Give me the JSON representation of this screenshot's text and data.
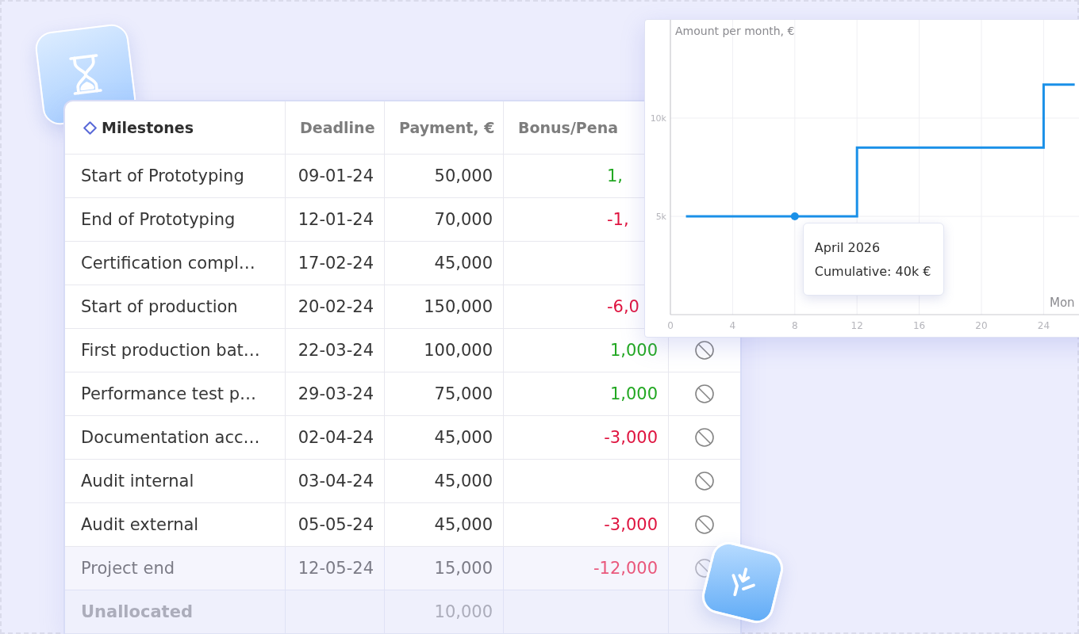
{
  "table": {
    "columns": [
      {
        "label": "Milestones",
        "kind": "title"
      },
      {
        "label": "Deadline",
        "kind": "value"
      },
      {
        "label": "Payment, €",
        "kind": "value"
      },
      {
        "label": "Bonus/Pena",
        "kind": "value"
      }
    ],
    "rows": [
      {
        "kind": "milestone",
        "name": "Start of Prototyping",
        "deadline": "09-01-24",
        "payment": "50,000",
        "bonus": {
          "text": "1,",
          "color": "#23a823",
          "clipped": true
        }
      },
      {
        "kind": "milestone",
        "name": "End of Prototyping",
        "deadline": "12-01-24",
        "payment": "70,000",
        "bonus": {
          "text": "-1,",
          "color": "#df1540",
          "clipped": true
        }
      },
      {
        "kind": "milestone",
        "name": "Certification compl…",
        "deadline": "17-02-24",
        "payment": "45,000"
      },
      {
        "kind": "milestone",
        "name": "Start of production",
        "deadline": "20-02-24",
        "payment": "150,000",
        "bonus": {
          "text": "-6,0",
          "color": "#df1540",
          "clipped": true
        }
      },
      {
        "kind": "milestone",
        "name": "First production bat…",
        "deadline": "22-03-24",
        "payment": "100,000",
        "bonus": {
          "text": "1,000",
          "color": "#23a823",
          "clipped": false
        },
        "status_icon": true
      },
      {
        "kind": "milestone",
        "name": "Performance test p…",
        "deadline": "29-03-24",
        "payment": "75,000",
        "bonus": {
          "text": "1,000",
          "color": "#23a823",
          "clipped": false
        },
        "status_icon": true
      },
      {
        "kind": "milestone",
        "name": "Documentation acc…",
        "deadline": "02-04-24",
        "payment": "45,000",
        "bonus": {
          "text": "-3,000",
          "color": "#df1540",
          "clipped": false
        },
        "status_icon": true
      },
      {
        "kind": "milestone",
        "name": "Audit internal",
        "deadline": "03-04-24",
        "payment": "45,000",
        "status_icon": true
      },
      {
        "kind": "milestone",
        "name": "Audit external",
        "deadline": "05-05-24",
        "payment": "45,000",
        "bonus": {
          "text": "-3,000",
          "color": "#df1540",
          "clipped": false
        },
        "status_icon": true
      },
      {
        "kind": "milestone",
        "name": "Project end",
        "deadline": "12-05-24",
        "payment": "15,000",
        "bonus": {
          "text": "-12,000",
          "color": "#e9587c",
          "clipped": false
        },
        "status_icon": true
      },
      {
        "kind": "summary",
        "name": "Unallocated",
        "payment": "10,000",
        "status_icon": false
      }
    ]
  },
  "chart": {
    "chart_data": {
      "type": "line",
      "ylabel": "Amount per month, €",
      "xlabel": "Mon",
      "x": [
        1,
        12,
        12,
        24,
        24,
        26
      ],
      "series": [
        {
          "color": "#1a90e8",
          "values": [
            5000,
            5000,
            8500,
            8500,
            11700,
            11700
          ]
        }
      ],
      "xlim": [
        0,
        30
      ],
      "ylim": [
        0,
        15000
      ],
      "xticks": [
        0,
        4,
        8,
        12,
        16,
        20,
        24
      ],
      "yticks": [
        {
          "value": 5000,
          "label": "5k"
        },
        {
          "value": 10000,
          "label": "10k"
        }
      ],
      "grid": true,
      "annotations": [
        {
          "x": 8,
          "y": 5000,
          "text": "April 2026"
        },
        "Cumulative: 40k €"
      ]
    }
  }
}
